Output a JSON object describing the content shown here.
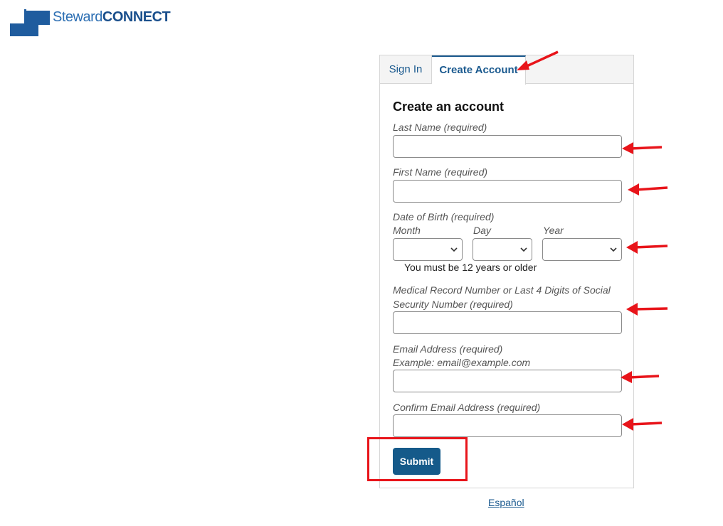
{
  "brand": {
    "part1": "Steward",
    "part2": "CONNECT",
    "logo_icon": "stepped-blocks-logo-icon"
  },
  "tabs": [
    {
      "label": "Sign In",
      "active": false
    },
    {
      "label": "Create Account",
      "active": true
    }
  ],
  "form": {
    "title": "Create an account",
    "last_name": {
      "label": "Last Name (required)",
      "value": ""
    },
    "first_name": {
      "label": "First Name (required)",
      "value": ""
    },
    "dob": {
      "label": "Date of Birth (required)",
      "month_label": "Month",
      "day_label": "Day",
      "year_label": "Year",
      "month_value": "",
      "day_value": "",
      "year_value": "",
      "note": "You must be 12 years or older"
    },
    "mrn": {
      "label_line1": "Medical Record Number or Last 4 Digits of Social",
      "label_line2": "Security Number (required)",
      "value": ""
    },
    "email": {
      "label": "Email Address (required)",
      "example": "Example: email@example.com",
      "value": ""
    },
    "confirm_email": {
      "label": "Confirm Email Address (required)",
      "value": ""
    },
    "submit_label": "Submit"
  },
  "footer_link": "Español",
  "annotations": {
    "arrow_color": "#e8141a",
    "box_color": "#e8141a"
  },
  "colors": {
    "brand_blue": "#1b5a8f",
    "button_blue": "#155a8a"
  }
}
